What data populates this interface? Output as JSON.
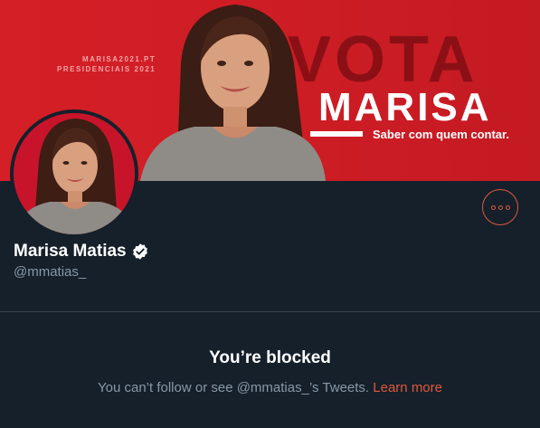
{
  "banner": {
    "small_line1": "MARISA2021.PT",
    "small_line2": "PRESIDENCIAIS 2021",
    "vota": "VOTA",
    "marisa": "MARISA",
    "slogan": "Saber com quem contar."
  },
  "profile": {
    "name": "Marisa Matias",
    "handle": "@mmatias_",
    "verified_icon": "verified-badge-icon",
    "more_icon": "more-options-icon"
  },
  "blocked": {
    "title": "You’re blocked",
    "message": "You can’t follow or see @mmatias_’s Tweets.",
    "learn_more": "Learn more"
  },
  "colors": {
    "background": "#15202b",
    "banner_red": "#d51f27",
    "accent": "#e0593d",
    "secondary_text": "#8899a6",
    "divider": "#38444d"
  }
}
